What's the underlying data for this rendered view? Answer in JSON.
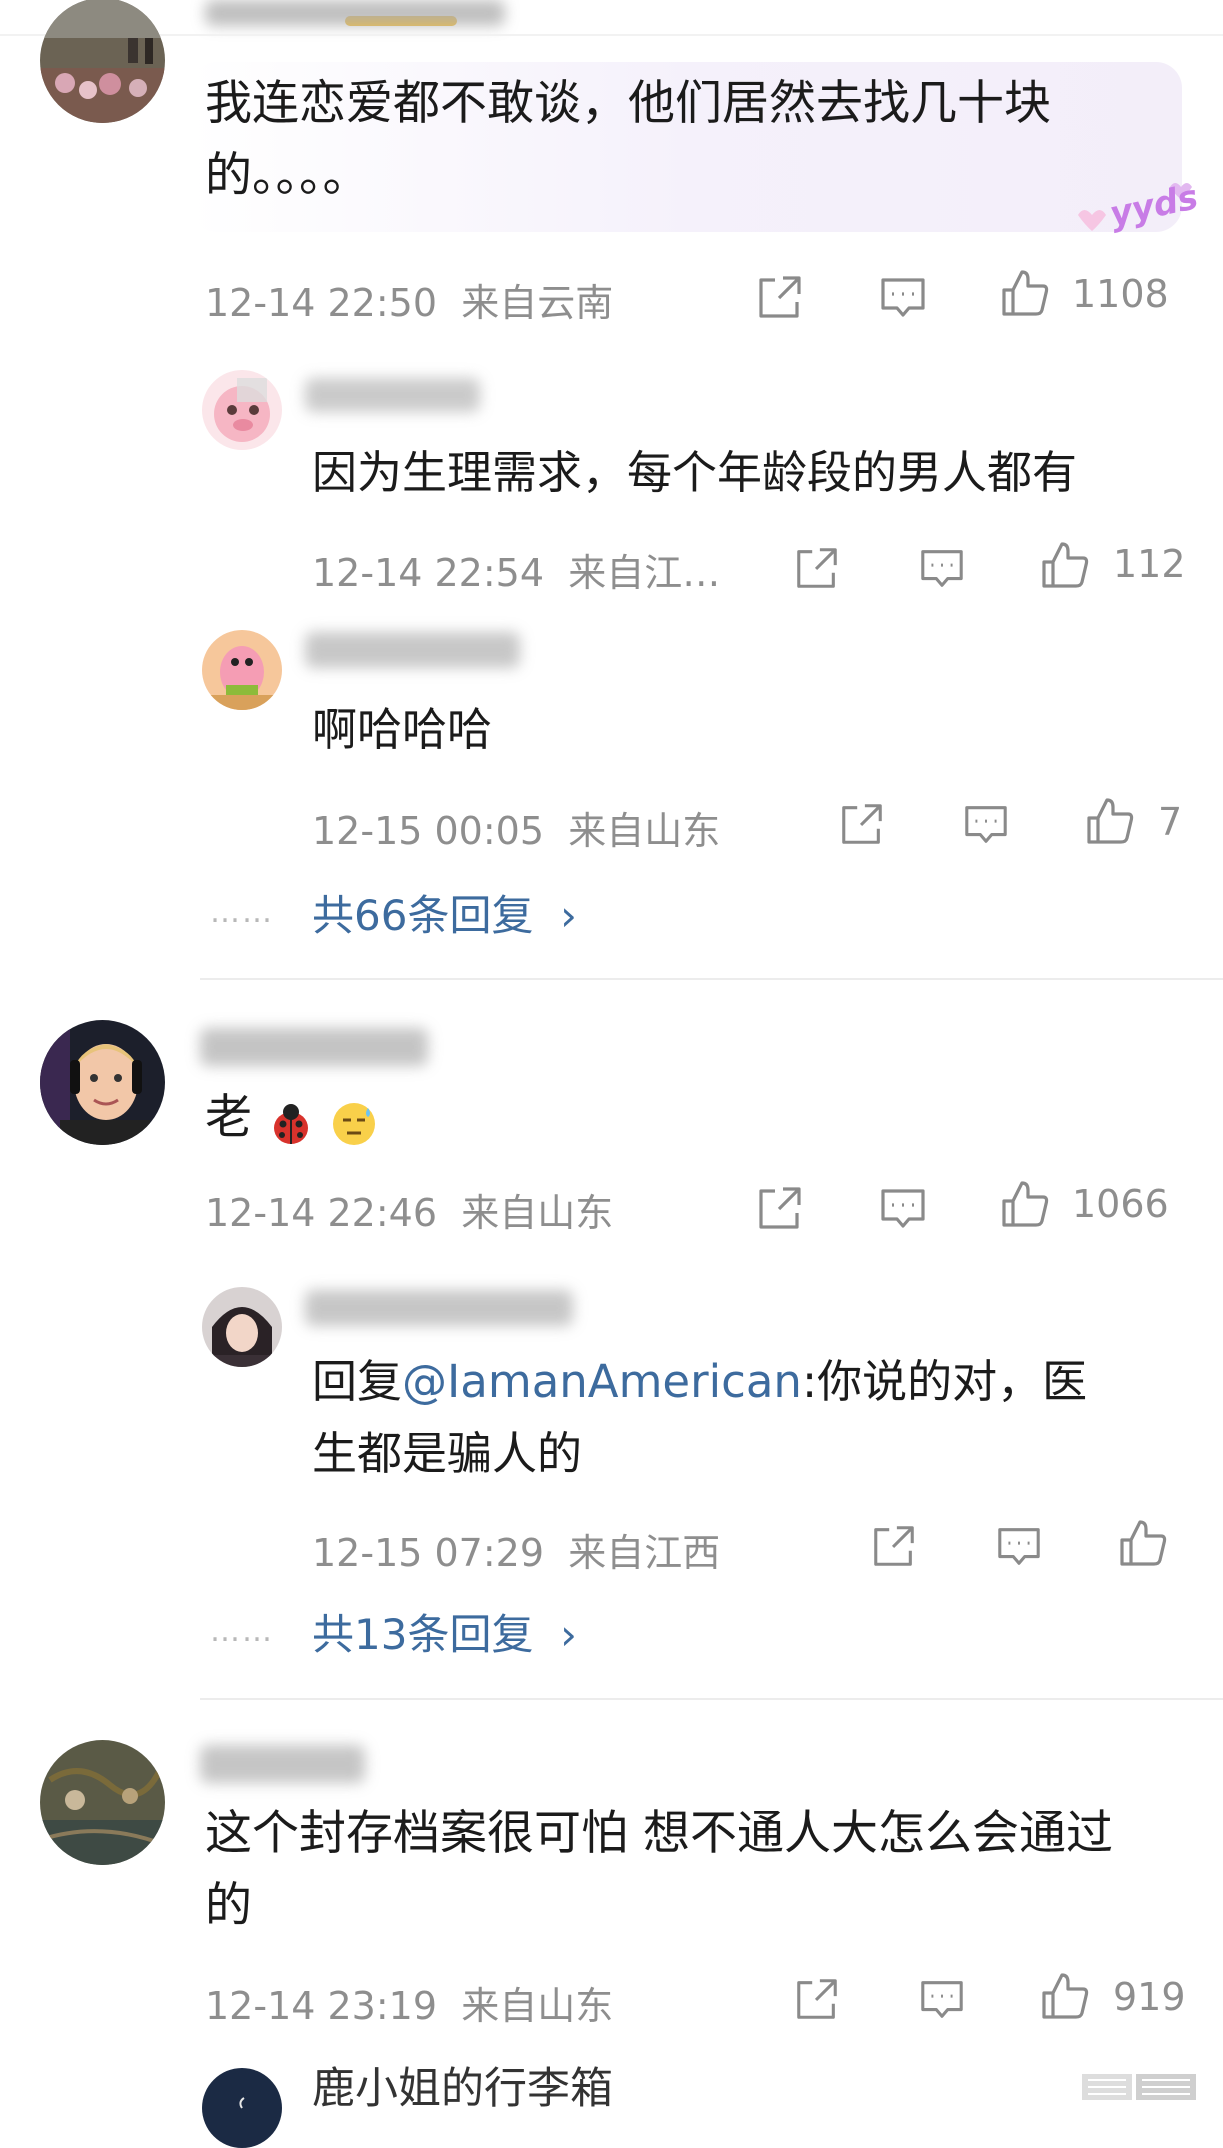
{
  "top_comment_1": {
    "text": "我连恋爱都不敢谈，他们居然去找几十块的。。。。",
    "line1": "我连恋爱都不敢谈，他们居然去找几十块",
    "line2": "的。。。。",
    "bubble_badge": "yyds",
    "time": "12-14 22:50",
    "location": "来自云南",
    "likes": "1108"
  },
  "reply_1a": {
    "text": "因为生理需求，每个年龄段的男人都有",
    "time": "12-14 22:54",
    "location": "来自江…",
    "likes": "112"
  },
  "reply_1b": {
    "text": "啊哈哈哈",
    "time": "12-15 00:05",
    "location": "来自山东",
    "likes": "7"
  },
  "more_replies_1": "共66条回复",
  "top_comment_2": {
    "text_prefix": "老",
    "time": "12-14 22:46",
    "location": "来自山东",
    "likes": "1066"
  },
  "reply_2a": {
    "reply_label": "回复",
    "mention": "@IamanAmerican",
    "line1_rest": ":你说的对，医",
    "line2": "生都是骗人的",
    "time": "12-15 07:29",
    "location": "来自江西",
    "likes": ""
  },
  "more_replies_2": "共13条回复",
  "top_comment_3": {
    "line1": "这个封存档案很可怕 想不通人大怎么会通过",
    "line2": "的",
    "time": "12-14 23:19",
    "location": "来自山东",
    "likes": "919"
  },
  "reply_3a": {
    "username": "鹿小姐的行李箱"
  },
  "more_arrow": "›",
  "dots": "……",
  "colors": {
    "link": "#3d6b9e",
    "meta": "#8e8e8e",
    "divider": "#ececec",
    "bubble": "#f6f1fb"
  }
}
